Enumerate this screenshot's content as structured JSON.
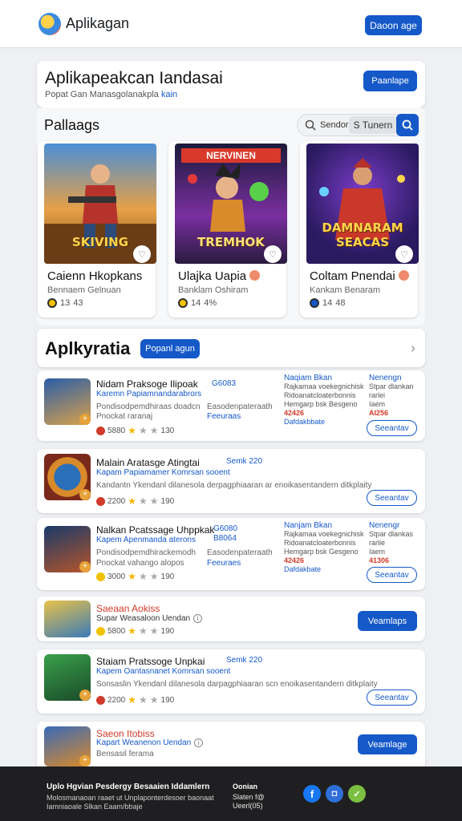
{
  "header": {
    "app_name": "Aplikagan",
    "button": "Daoon age"
  },
  "hero": {
    "title": "Aplikapeakcan Iandasai",
    "subtitle": "Popat Gan Manasgolanakpla",
    "subtitle_link": "kain",
    "button": "Paanlape"
  },
  "popular": {
    "title": "Pallaags",
    "search_placeholder": "Sendorn",
    "search_term": "S Tunern",
    "items": [
      {
        "art_text": "SKIVING",
        "name": "Caienn Hkopkans",
        "developer": "Bennaem Gelnuan",
        "rating": "13",
        "reviews": "43"
      },
      {
        "art_top": "NERVINEN",
        "art_text": "TREMHOK",
        "name": "Ulajka Uapia",
        "developer": "Banklam Oshiram",
        "rating": "14",
        "reviews": "4%"
      },
      {
        "art_text": "DAMNARAM SEACAS",
        "name": "Coltam Pnendai",
        "developer": "Kankam Benaram",
        "rating": "14",
        "reviews": "48"
      }
    ]
  },
  "section": {
    "title": "Aplkyratia",
    "button": "Popanl agun"
  },
  "apps": [
    {
      "title": "Nidam Praksoge Ilipoak",
      "tag": "G6083",
      "subtitle": "Karemn Papiamnandarabrors",
      "desc1": "Pondisodpemdhiraas doadcn",
      "desc2": "Pnockat raranaj",
      "mid1": "Easodenpateraath",
      "mid2": "Feeuraas",
      "rating": "5880",
      "count": "130",
      "c1_head": "Naqiam Bkan",
      "c1_lines": [
        "Rajkamaa voekegnichisk",
        "Ridoanatcloaterbonnis",
        "Hemgarp bsk Besgeno"
      ],
      "c1_red": "42426",
      "c1_link": "Dafdakbbate",
      "c2_head": "Nenengn",
      "c2_lines": [
        "Stpar dlankan",
        "rarlei",
        "Iaem"
      ],
      "c2_red": "AI256",
      "action": "Seeantav"
    },
    {
      "title": "Malain Aratasge Atingtai",
      "tag": "Semk 220",
      "subtitle": "Kapam Papiamamer Komrsan sooent",
      "desc1": "Kandantn Ykendanl dilanesola derpagphiaaran ar enoikasentandern ditkplaity",
      "rating": "2200",
      "count": "190",
      "action": "Seeantav"
    },
    {
      "title": "Nalkan Pcatssage Uhppkak",
      "tag": "G6080",
      "tag2": "B8064",
      "subtitle": "Kapem Apenmanda aterons",
      "desc1": "Pondisodpemdhirackemodh",
      "desc2": "Pnockat vahango alopos",
      "mid1": "Easodenpateraath",
      "mid2": "Feeuraes",
      "rating": "3000",
      "count": "190",
      "c1_head": "Nanjam Bkan",
      "c1_lines": [
        "Rajkamaa voekegnichisk",
        "Ridoanatcloaterbonnis",
        "Hemgarp bsk Gesgeno"
      ],
      "c1_red": "42426",
      "c1_link": "Dafdakbate",
      "c2_head": "Nenengr",
      "c2_lines": [
        "Stpar dlankas",
        "rarlie",
        "Iaem"
      ],
      "c2_red": "41306",
      "action": "Seeantav"
    },
    {
      "title": "Saeaan Aokiss",
      "subtitle": "Supar Weasaloon Uendan",
      "rating": "5800",
      "count": "190",
      "action": "Veamlaps"
    },
    {
      "title": "Staiam Pratssoge Unpkai",
      "tag": "Semk 220",
      "subtitle": "Kapem Oantasnanet Komrsan sooent",
      "desc1": "Sonsaslin Ykendanl dilanesola darpagphiaaran scn enoikasentandern ditkplaity",
      "rating": "2200",
      "count": "190",
      "action": "Seeantav"
    },
    {
      "title": "Saeon Itobiss",
      "subtitle": "Kapart Weanenon Uendan",
      "desc1": "Bensasil ferama",
      "rating": "5500",
      "count": "190",
      "action": "Veamlage"
    }
  ],
  "footer": {
    "title": "Uplo Hgvian Pesdergy Besaaien Iddamlern",
    "lines": [
      "Molosmanaoan raaet ut Unplaponterdesoer baonaat",
      "Iamniaoale Slkan Eaam/bbaje"
    ],
    "col2": [
      "Oonian",
      "Slaten f@",
      "Ueerl(05)"
    ]
  },
  "colors": {
    "accent": "#1559c9",
    "footer": "#1f1f21",
    "price": "#d13a2a"
  },
  "icons": [
    "search-icon",
    "heart-icon",
    "coin-icon",
    "star-icon",
    "info-icon",
    "chevron-right-icon",
    "facebook-icon",
    "instagram-icon",
    "chat-icon"
  ]
}
